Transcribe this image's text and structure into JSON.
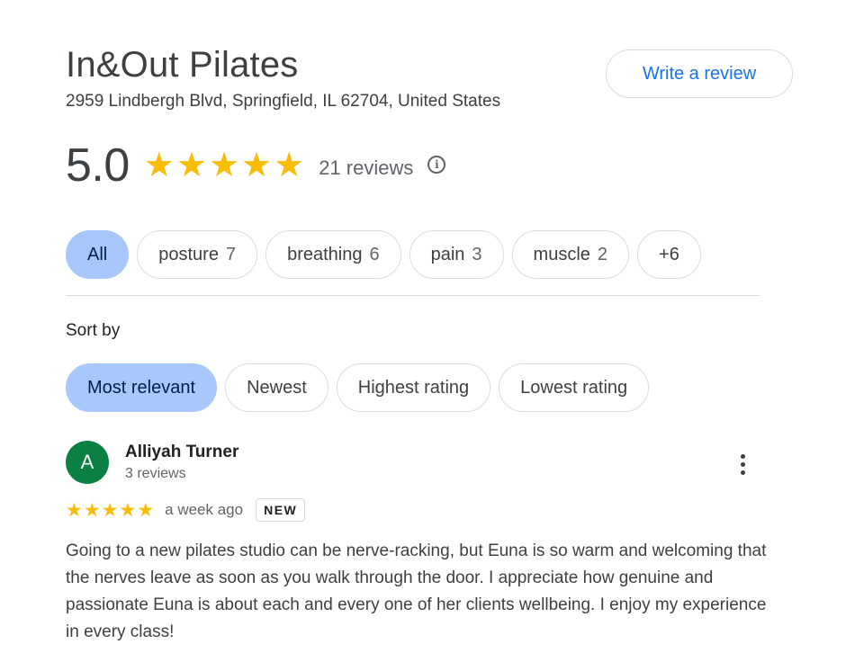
{
  "business": {
    "name": "In&Out Pilates",
    "address": "2959 Lindbergh Blvd, Springfield, IL 62704, United States"
  },
  "write_review_label": "Write a review",
  "rating": {
    "value": "5.0",
    "stars": 5,
    "reviews_label": "21 reviews",
    "info_icon": "info-icon"
  },
  "filters": [
    {
      "label": "All",
      "count": "",
      "active": true
    },
    {
      "label": "posture",
      "count": "7",
      "active": false
    },
    {
      "label": "breathing",
      "count": "6",
      "active": false
    },
    {
      "label": "pain",
      "count": "3",
      "active": false
    },
    {
      "label": "muscle",
      "count": "2",
      "active": false
    },
    {
      "label": "+6",
      "count": "",
      "active": false
    }
  ],
  "sort": {
    "label": "Sort by",
    "options": [
      {
        "label": "Most relevant",
        "active": true
      },
      {
        "label": "Newest",
        "active": false
      },
      {
        "label": "Highest rating",
        "active": false
      },
      {
        "label": "Lowest rating",
        "active": false
      }
    ]
  },
  "review": {
    "avatar_letter": "A",
    "avatar_color": "#0b8043",
    "name": "Alliyah Turner",
    "sub": "3 reviews",
    "stars": 5,
    "date": "a week ago",
    "badge": "NEW",
    "text": "Going to a new pilates studio can be nerve-racking, but Euna is so warm and welcoming that the nerves leave as soon as you walk through the door. I appreciate how genuine and passionate Euna is about each and every one of her clients wellbeing. I enjoy my experience in every class!"
  },
  "colors": {
    "accent": "#1a73e8",
    "star": "#fbbc04",
    "active_chip": "#a8c7fa"
  }
}
